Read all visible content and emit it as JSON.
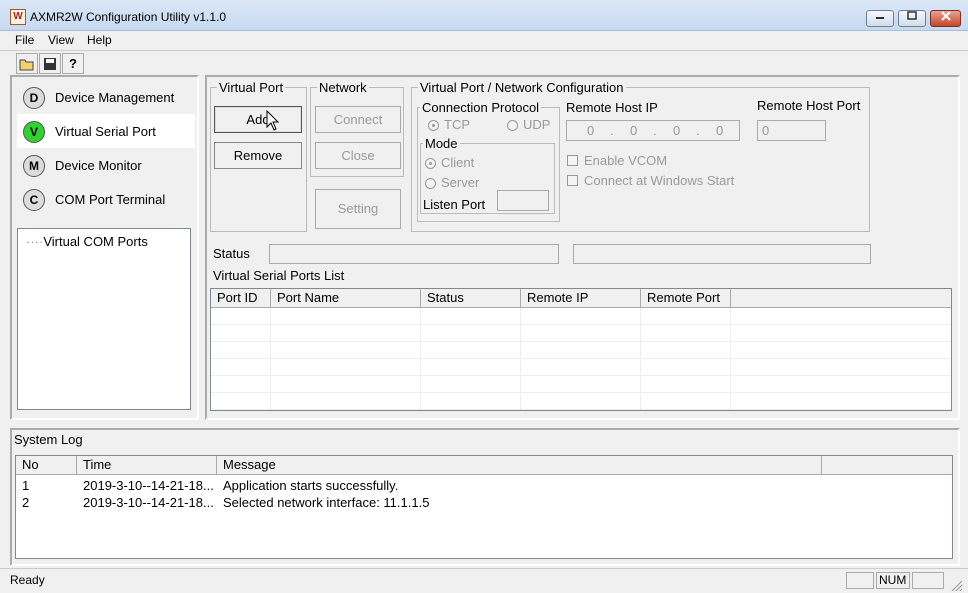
{
  "window": {
    "title": "AXMR2W Configuration Utility v1.1.0",
    "controls": [
      "minimize",
      "maximize",
      "close"
    ]
  },
  "menu": [
    "File",
    "View",
    "Help"
  ],
  "toolbar": [
    {
      "icon": "open-folder-icon"
    },
    {
      "icon": "save-icon"
    },
    {
      "icon": "help-icon",
      "glyph": "?"
    }
  ],
  "nav": [
    {
      "letter": "D",
      "label": "Device Management"
    },
    {
      "letter": "V",
      "label": "Virtual Serial Port"
    },
    {
      "letter": "M",
      "label": "Device Monitor"
    },
    {
      "letter": "C",
      "label": "COM Port Terminal"
    }
  ],
  "tree": {
    "item": "Virtual COM Ports"
  },
  "virtual_port": {
    "legend": "Virtual Port",
    "add": "Add",
    "remove": "Remove"
  },
  "network": {
    "legend": "Network",
    "connect": "Connect",
    "close": "Close",
    "setting": "Setting"
  },
  "config": {
    "legend": "Virtual Port / Network Configuration",
    "protocol_legend": "Connection Protocol",
    "tcp": "TCP",
    "udp": "UDP",
    "mode_legend": "Mode",
    "client": "Client",
    "server": "Server",
    "listen_port": "Listen Port",
    "remote_host_ip_label": "Remote Host IP",
    "remote_host_ip": [
      "0",
      "0",
      "0",
      "0"
    ],
    "remote_host_port_label": "Remote Host Port",
    "remote_host_port": "0",
    "enable_vcom": "Enable VCOM",
    "connect_at_start": "Connect at Windows Start"
  },
  "status": {
    "label": "Status"
  },
  "ports_list": {
    "title": "Virtual Serial Ports List",
    "columns": [
      "Port ID",
      "Port Name",
      "Status",
      "Remote IP",
      "Remote Port"
    ]
  },
  "system_log": {
    "title": "System Log",
    "columns": [
      "No",
      "Time",
      "Message"
    ],
    "rows": [
      {
        "no": "1",
        "time": "2019-3-10--14-21-18...",
        "message": "Application starts successfully."
      },
      {
        "no": "2",
        "time": "2019-3-10--14-21-18...",
        "message": "Selected network interface: 11.1.1.5"
      }
    ]
  },
  "statusbar": {
    "text": "Ready",
    "num": "NUM"
  }
}
